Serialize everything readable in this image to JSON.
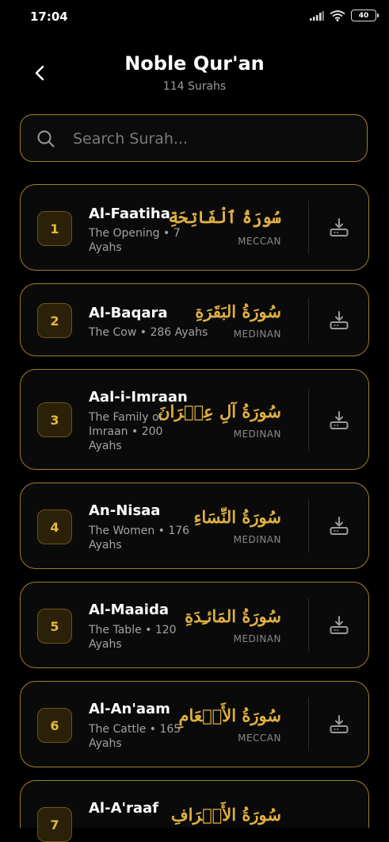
{
  "status_bar": {
    "time": "17:04",
    "battery": "40"
  },
  "header": {
    "title": "Noble Qur'an",
    "subtitle": "114 Surahs"
  },
  "search": {
    "placeholder": "Search Surah..."
  },
  "colors": {
    "accent": "#e0b040",
    "border": "#a07e2a",
    "background": "#000000"
  },
  "surahs": [
    {
      "number": "1",
      "name": "Al-Faatiha",
      "meaning": "The Opening • 7 Ayahs",
      "arabic": "سُورَةُ ٱلْفَاتِحَةِ",
      "type": "MECCAN"
    },
    {
      "number": "2",
      "name": "Al-Baqara",
      "meaning": "The Cow • 286 Ayahs",
      "arabic": "سُورَةُ البَقَرَةِ",
      "type": "MEDINAN"
    },
    {
      "number": "3",
      "name": "Aal-i-Imraan",
      "meaning": "The Family of Imraan • 200 Ayahs",
      "arabic": "سُورَةُ آلِ عِمۡرَانَ",
      "type": "MEDINAN"
    },
    {
      "number": "4",
      "name": "An-Nisaa",
      "meaning": "The Women • 176 Ayahs",
      "arabic": "سُورَةُ النِّسَاءِ",
      "type": "MEDINAN"
    },
    {
      "number": "5",
      "name": "Al-Maaida",
      "meaning": "The Table • 120 Ayahs",
      "arabic": "سُورَةُ المَائـِدَةِ",
      "type": "MEDINAN"
    },
    {
      "number": "6",
      "name": "Al-An'aam",
      "meaning": "The Cattle • 165 Ayahs",
      "arabic": "سُورَةُ الأَنۡعَامِ",
      "type": "MECCAN"
    },
    {
      "number": "7",
      "name": "Al-A'raaf",
      "meaning": "",
      "arabic": "سُورَةُ الأَعۡرَافِ",
      "type": ""
    }
  ]
}
